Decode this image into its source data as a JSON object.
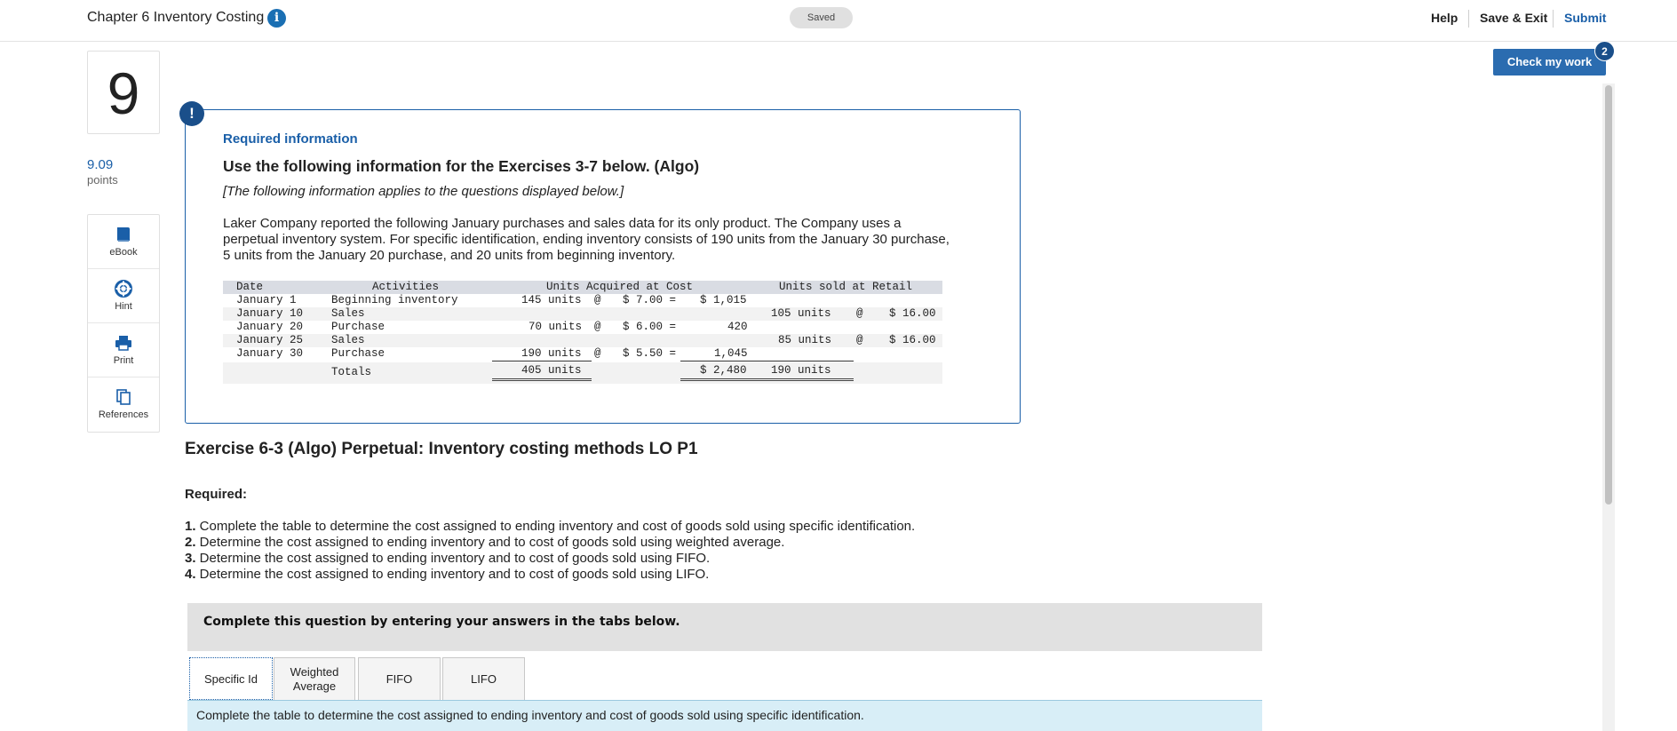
{
  "header": {
    "title": "Chapter 6 Inventory Costing",
    "saved": "Saved",
    "help": "Help",
    "save_exit": "Save & Exit",
    "submit": "Submit"
  },
  "check_work": {
    "label": "Check my work",
    "badge": "2"
  },
  "question": {
    "number": "9",
    "points_value": "9.09",
    "points_label": "points"
  },
  "tools": [
    {
      "label": "eBook",
      "icon": "book-icon"
    },
    {
      "label": "Hint",
      "icon": "lifebuoy-icon"
    },
    {
      "label": "Print",
      "icon": "printer-icon"
    },
    {
      "label": "References",
      "icon": "copy-icon"
    }
  ],
  "required_info": {
    "heading": "Required information",
    "title": "Use the following information for the Exercises 3-7 below. (Algo)",
    "note": "[The following information applies to the questions displayed below.]",
    "paragraph": "Laker Company reported the following January purchases and sales data for its only product. The Company uses a perpetual inventory system. For specific identification, ending inventory consists of 190 units from the January 30 purchase, 5 units from the January 20 purchase, and 20 units from beginning inventory."
  },
  "inventory_table": {
    "headers": {
      "date": "Date",
      "activities": "Activities",
      "acquired": "Units Acquired at Cost",
      "sold": "Units sold at Retail"
    },
    "rows": [
      {
        "date": "January 1",
        "activity": "Beginning inventory",
        "units": "145 units",
        "at": "@",
        "cost": "$ 7.00 =",
        "total": "$ 1,015",
        "sold_units": "",
        "sold_at": "",
        "price": ""
      },
      {
        "date": "January 10",
        "activity": "Sales",
        "units": "",
        "at": "",
        "cost": "",
        "total": "",
        "sold_units": "105 units",
        "sold_at": "@",
        "price": "$ 16.00"
      },
      {
        "date": "January 20",
        "activity": "Purchase",
        "units": "70 units",
        "at": "@",
        "cost": "$ 6.00 =",
        "total": "420",
        "sold_units": "",
        "sold_at": "",
        "price": ""
      },
      {
        "date": "January 25",
        "activity": "Sales",
        "units": "",
        "at": "",
        "cost": "",
        "total": "",
        "sold_units": "85 units",
        "sold_at": "@",
        "price": "$ 16.00"
      },
      {
        "date": "January 30",
        "activity": "Purchase",
        "units": "190 units",
        "at": "@",
        "cost": "$ 5.50 =",
        "total": "1,045",
        "sold_units": "",
        "sold_at": "",
        "price": ""
      }
    ],
    "totals": {
      "label": "Totals",
      "units": "405 units",
      "total": "$ 2,480",
      "sold_units": "190 units"
    }
  },
  "exercise": {
    "title": "Exercise 6-3 (Algo) Perpetual: Inventory costing methods LO P1",
    "required_label": "Required:",
    "items": [
      {
        "num": "1.",
        "text": " Complete the table to determine the cost assigned to ending inventory and cost of goods sold using specific identification."
      },
      {
        "num": "2.",
        "text": " Determine the cost assigned to ending inventory and to cost of goods sold using weighted average."
      },
      {
        "num": "3.",
        "text": " Determine the cost assigned to ending inventory and to cost of goods sold using FIFO."
      },
      {
        "num": "4.",
        "text": " Determine the cost assigned to ending inventory and to cost of goods sold using LIFO."
      }
    ]
  },
  "complete_prompt": "Complete this question by entering your answers in the tabs below.",
  "tabs": [
    {
      "line1": "Specific Id",
      "line2": ""
    },
    {
      "line1": "Weighted",
      "line2": "Average"
    },
    {
      "line1": "FIFO",
      "line2": ""
    },
    {
      "line1": "LIFO",
      "line2": ""
    }
  ],
  "tab_instruction": "Complete the table to determine the cost assigned to ending inventory and cost of goods sold using specific identification."
}
